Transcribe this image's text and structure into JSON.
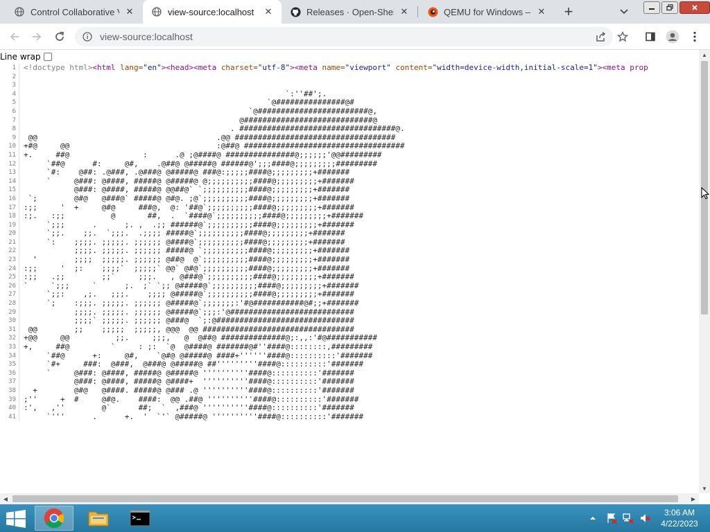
{
  "browser": {
    "tabs": [
      {
        "title": "Control Collaborative Vir",
        "active": false,
        "icon": "globe-icon"
      },
      {
        "title": "view-source:localhost",
        "active": true,
        "icon": "globe-icon"
      },
      {
        "title": "Releases · Open-Shell/Op",
        "active": false,
        "icon": "github-icon"
      },
      {
        "title": "QEMU for Windows – Ins",
        "active": false,
        "icon": "qemu-icon"
      }
    ],
    "address": "view-source:localhost"
  },
  "content": {
    "line_wrap_label": "Line wrap",
    "line_wrap_checked": false,
    "first_line": {
      "doctype": "<!doctype html>",
      "html_open": "<html ",
      "lang_attr": "lang=",
      "lang_val": "\"en\"",
      "head": "><head><meta ",
      "charset_attr": "charset=",
      "charset_val": "\"utf-8\"",
      "meta2": "><meta ",
      "name_attr": "name=",
      "name_val": "\"viewport\"",
      "sp": " ",
      "content_attr": "content=",
      "content_val": "\"width=device-width,initial-scale=1\"",
      "meta3": "><meta prop"
    },
    "lines": [
      "",
      "",
      "                                                         `:''##';.",
      "                                                     `@###############@#",
      "                                                 `@########################@,",
      "                                               @############################@",
      "                                             . ##################################@.",
      " @@                                       .@@ ###################################",
      "+#@     @@                                :@##@ ###################################",
      "+.     ##@                :      .@ ;@####@ ###############@;;;;;;'@@#########",
      "     `##@      #:     @#,    .@##@ @#####@ ######@';;;####@;;;;;;;;;#########",
      "     `#:    @##: .@###, .@###@ @#####@ ###@:;;;;;####@;;;;;;;;;+#######",
      "     `     @###: @####, #####@ @#####@ @;;;;;;;;;;####@;;;;;;;;;+#######",
      "           @###: @####, #####@ @@##@` `;;;;;;;;;;####@;;;;;;;;;+#######",
      " `;        @#@   @###@` #####@ @#@. ;@`;;;;;;;;;;####@;;;;;;;;;+#######",
      ":;;     '  +     @#@     ###@,  @: '##@`;;;;;;;;;;####@;;;;;;;;;+#######",
      ":;.   :;;          @       ##,  .  `####@`;;;;;;;;;;####@;;;;;;;;;+#######",
      "     `;;;      .      ;. ,  .;; ######@`;;;;;;;;;;####@;;;;;;;;;+#######",
      "     `;;.    ;;.  `;;;.  .;;;; #####@`;;;;;;;;;;####@;;;;;;;;;+#######",
      "     `:    ;;;;. ;;;;;. ;;;;;; @####@`;;;;;;;;;;####@;;;;;;;;;+#######",
      "           ;;;;. ;;;;;. ;;;;;; #####@ `;;;;;;;;;;####@;;;;;;;;;+#######",
      "  '        ;;;;  ;;;;;. ;;;;;; @##@  @`;;;;;;;;;;####@;;;;;;;;;+#######",
      ":;;     '  ;:    ;;;;`  ;;;;;` @@` @#@`;;;;;;;;;;####@;;;;;;;;;+#######",
      ":;;   .;;        ;;`     ;;;.   , @###@`;;;;;;;;;;####@;;;;;;;;;+#######",
      "`     `;;;     `      ;.  ;` `;; @#####@`;;;;;;;;;;####@;;;;;;;;;+#######",
      "     `;;:    ,;.   ;;;.    ;;;; @#####@`;;;;;;;;;;####@;;;;;;;;;+#######",
      "     `;    :;;;. ;;;;;. ;;;;;; @#####@`;;;;;;;:'#@###########@#;;+#######",
      "           ;;;;. ;;;;;. ;;;;;; @#####@`;;;:'@###########################",
      "           ;;;;` ;;;;;. ;;;;;; @###@  `;:@##############################",
      " @@        ;;    ;;;;;  ;;;;;, @@@  @@ #################################",
      "+@@     @@          ;;.     ;;;,   @  @##@ ##############@;:,,:'#@###########",
      "+,     ##@         `     : ;:  `@  @####@ #######@#''####@::::::::,#########",
      "     `##@      +:     @#,    `@#@ @#####@ ####+''''''####@::::::::::'#######",
      "     `#+     ###:  @###,  @###@ @#####@ ##'''''''''####@::::::::::'#######",
      "     `     @###: @####, #####@ @#####@ ''''''''''####@::::::::::'#######",
      "           @###: @####, #####@ @####+  ''''''''''####@::::::::::'#######",
      "  +        @#@   @####. #####@ @### .@ ''''''''''####@::::::::::'#######",
      ";''     +  #     @#@.    ####:  @@ .##@ ''''''''''####@::::::::::'#######",
      ":',   ,''        @`      ##;  `  ,###@ ''''''''''####@::::::::::'#######",
      "     `'''      .      +.  '  `'` @#####@ ''''''''''####@::::::::::'#######"
    ]
  },
  "taskbar": {
    "time": "3:06 AM",
    "date": "4/22/2023"
  },
  "colors": {
    "tabstrip": "#dee1e6",
    "taskbar": "#2b7fa6",
    "tag": "#881280",
    "attr": "#994500",
    "value": "#1a1aa6"
  }
}
